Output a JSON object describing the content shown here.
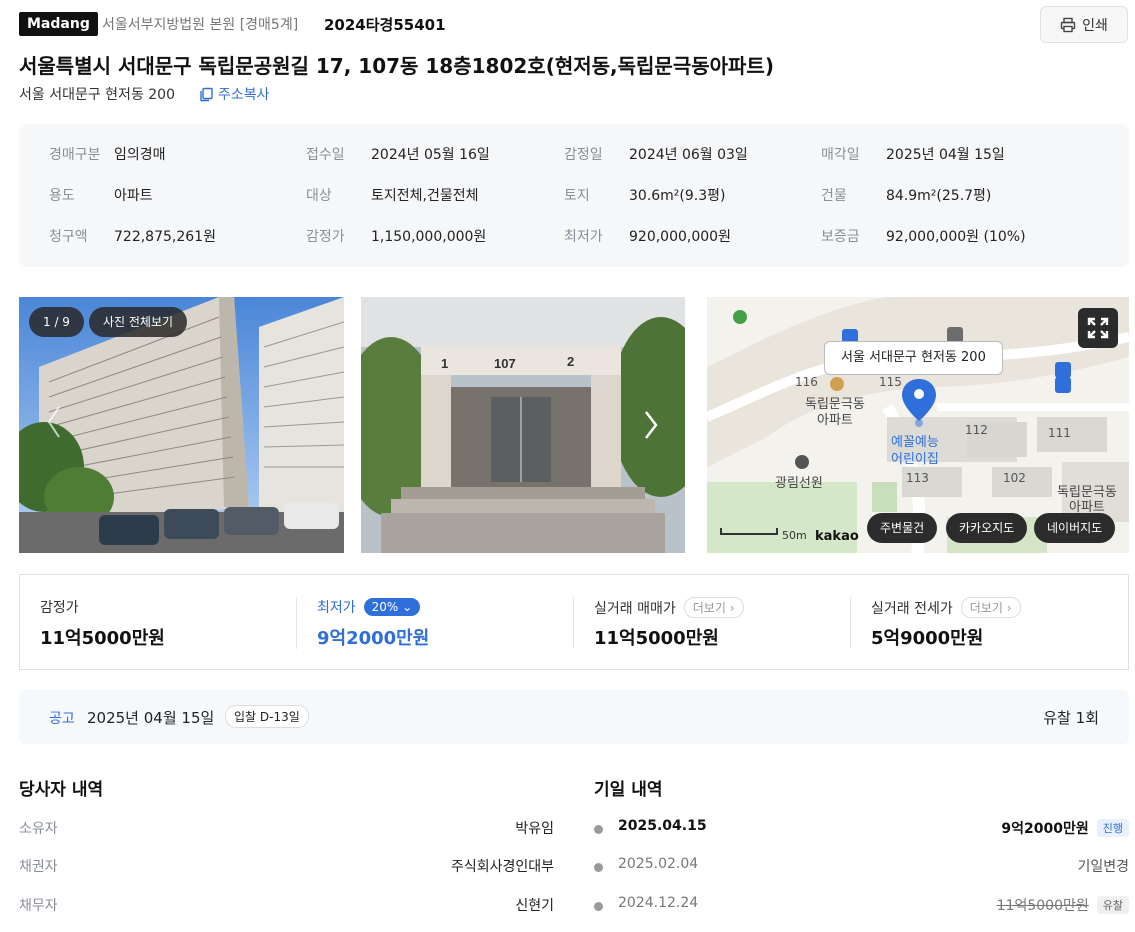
{
  "header": {
    "brand": "Madang",
    "court": "서울서부지방법원 본원 [경매5계]",
    "case_number": "2024타경55401",
    "print_label": "인쇄"
  },
  "property": {
    "title": "서울특별시 서대문구 독립문공원길 17, 107동 18층1802호(현저동,독립문극동아파트)",
    "sub_address": "서울 서대문구 현저동 200",
    "copy_label": "주소복사"
  },
  "info": [
    [
      {
        "label": "경매구분",
        "value": "임의경매"
      },
      {
        "label": "접수일",
        "value": "2024년 05월 16일"
      },
      {
        "label": "감정일",
        "value": "2024년 06월 03일"
      },
      {
        "label": "매각일",
        "value": "2025년 04월 15일"
      }
    ],
    [
      {
        "label": "용도",
        "value": "아파트"
      },
      {
        "label": "대상",
        "value": "토지전체,건물전체"
      },
      {
        "label": "토지",
        "value": "30.6m²(9.3평)"
      },
      {
        "label": "건물",
        "value": "84.9m²(25.7평)"
      }
    ],
    [
      {
        "label": "청구액",
        "value": "722,875,261원"
      },
      {
        "label": "감정가",
        "value": "1,150,000,000원"
      },
      {
        "label": "최저가",
        "value": "920,000,000원"
      },
      {
        "label": "보증금",
        "value": "92,000,000원 (10%)"
      }
    ]
  ],
  "gallery": {
    "counter": "1 / 9",
    "view_all": "사진 전체보기",
    "building_label_1": "1",
    "building_label_2": "107",
    "building_label_3": "2"
  },
  "map": {
    "tooltip": "서울 서대문구 현저동 200",
    "place_1": "독립문극동",
    "place_1b": "아파트",
    "place_2": "예꼴예능",
    "place_2b": "어린이집",
    "place_3": "광림선원",
    "place_4": "독립문극동",
    "place_4b": "아파트",
    "num_116": "116",
    "num_115": "115",
    "num_112": "112",
    "num_111": "111",
    "num_113": "113",
    "num_102": "102",
    "scale": "50m",
    "logo": "kakao",
    "btn_nearby": "주변물건",
    "btn_kakao": "카카오지도",
    "btn_naver": "네이버지도"
  },
  "prices": [
    {
      "label": "감정가",
      "value": "11억5000만원"
    },
    {
      "label": "최저가",
      "value": "9억2000만원",
      "badge": "20%"
    },
    {
      "label": "실거래 매매가",
      "value": "11억5000만원",
      "more": "더보기"
    },
    {
      "label": "실거래 전세가",
      "value": "5억9000만원",
      "more": "더보기"
    }
  ],
  "notice": {
    "label": "공고",
    "date": "2025년 04월 15일",
    "dday": "입찰 D-13일",
    "failed": "유찰 1회"
  },
  "parties": {
    "title": "당사자 내역",
    "rows": [
      {
        "label": "소유자",
        "value": "박유임"
      },
      {
        "label": "채권자",
        "value": "주식회사경인대부"
      },
      {
        "label": "채무자",
        "value": "신현기"
      }
    ]
  },
  "dates": {
    "title": "기일 내역",
    "rows": [
      {
        "date": "2025.04.15",
        "value": "9억2000만원",
        "tag": "진행"
      },
      {
        "date": "2025.02.04",
        "value": "기일변경",
        "tag": ""
      },
      {
        "date": "2024.12.24",
        "value": "11억5000만원",
        "tag": "유찰"
      }
    ]
  },
  "colors": {
    "accent": "#2f6fdb",
    "muted": "#8a8f98",
    "panel": "#f6f7f9"
  }
}
